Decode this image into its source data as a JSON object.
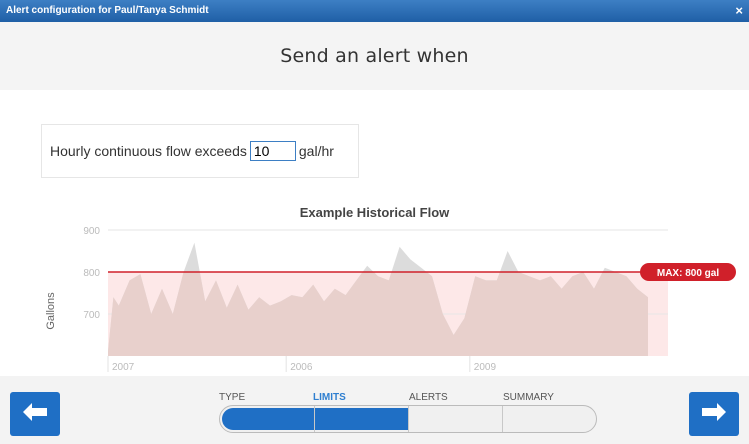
{
  "window": {
    "title": "Alert configuration for Paul/Tanya Schmidt",
    "close_glyph": "×"
  },
  "header": {
    "title": "Send an alert when"
  },
  "rule": {
    "label": "Hourly continuous flow exceeds",
    "value": "10",
    "unit": "gal/hr"
  },
  "chart_data": {
    "type": "area",
    "title": "Example Historical Flow",
    "ylabel": "Gallons",
    "ylim": [
      600,
      900
    ],
    "y_ticks": [
      "700",
      "800",
      "900"
    ],
    "x_ticks": [
      {
        "label": "2007",
        "x": 0.0
      },
      {
        "label": "2006",
        "x": 0.33
      },
      {
        "label": "2009",
        "x": 0.67
      }
    ],
    "threshold": {
      "value": 800,
      "label": "MAX: 800 gal",
      "color": "#d0202a"
    },
    "colors": {
      "area_below": "#e8d0cc",
      "area_above": "#dcdcdc",
      "zone": "#fde8e8"
    },
    "x": [
      0,
      0.01,
      0.02,
      0.04,
      0.06,
      0.08,
      0.1,
      0.12,
      0.14,
      0.16,
      0.18,
      0.2,
      0.22,
      0.24,
      0.26,
      0.28,
      0.3,
      0.32,
      0.34,
      0.36,
      0.38,
      0.4,
      0.42,
      0.44,
      0.46,
      0.48,
      0.5,
      0.52,
      0.54,
      0.56,
      0.58,
      0.6,
      0.62,
      0.64,
      0.66,
      0.68,
      0.7,
      0.72,
      0.74,
      0.76,
      0.78,
      0.8,
      0.82,
      0.84,
      0.86,
      0.88,
      0.9,
      0.92,
      0.94,
      0.96,
      0.98,
      1
    ],
    "values": [
      610,
      740,
      720,
      780,
      795,
      700,
      760,
      700,
      800,
      870,
      730,
      780,
      715,
      770,
      710,
      740,
      720,
      730,
      745,
      740,
      770,
      730,
      760,
      745,
      780,
      815,
      790,
      780,
      860,
      830,
      810,
      790,
      700,
      650,
      690,
      790,
      780,
      780,
      850,
      800,
      790,
      780,
      790,
      760,
      790,
      800,
      760,
      810,
      800,
      790,
      760,
      740
    ]
  },
  "steps": [
    {
      "label": "TYPE",
      "active": false
    },
    {
      "label": "LIMITS",
      "active": true
    },
    {
      "label": "ALERTS",
      "active": false
    },
    {
      "label": "SUMMARY",
      "active": false
    }
  ],
  "progress": {
    "fraction": 0.5
  },
  "nav": {
    "prev_glyph": "🡐",
    "next_glyph": "🡒"
  }
}
